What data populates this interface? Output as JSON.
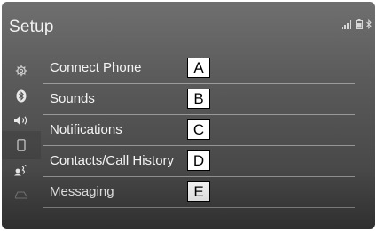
{
  "screen": {
    "title": "Setup"
  },
  "status_bar": {
    "icons": [
      "signal-icon",
      "battery-icon",
      "bluetooth-icon"
    ]
  },
  "sidebar": {
    "items": [
      {
        "icon": "gear-icon"
      },
      {
        "icon": "bluetooth-icon"
      },
      {
        "icon": "speaker-icon"
      },
      {
        "icon": "phone-icon",
        "active": true
      },
      {
        "icon": "voice-icon"
      },
      {
        "icon": "car-icon"
      }
    ]
  },
  "menu": {
    "items": [
      {
        "label": "Connect Phone",
        "callout": "A"
      },
      {
        "label": "Sounds",
        "callout": "B"
      },
      {
        "label": "Notifications",
        "callout": "C"
      },
      {
        "label": "Contacts/Call History",
        "callout": "D"
      },
      {
        "label": "Messaging",
        "callout": "E"
      }
    ]
  },
  "colors": {
    "screen_top": "#6f6f6f",
    "screen_bottom": "#3f3f3f",
    "text": "#f4f4f4",
    "divider": "#d2d2d2"
  }
}
